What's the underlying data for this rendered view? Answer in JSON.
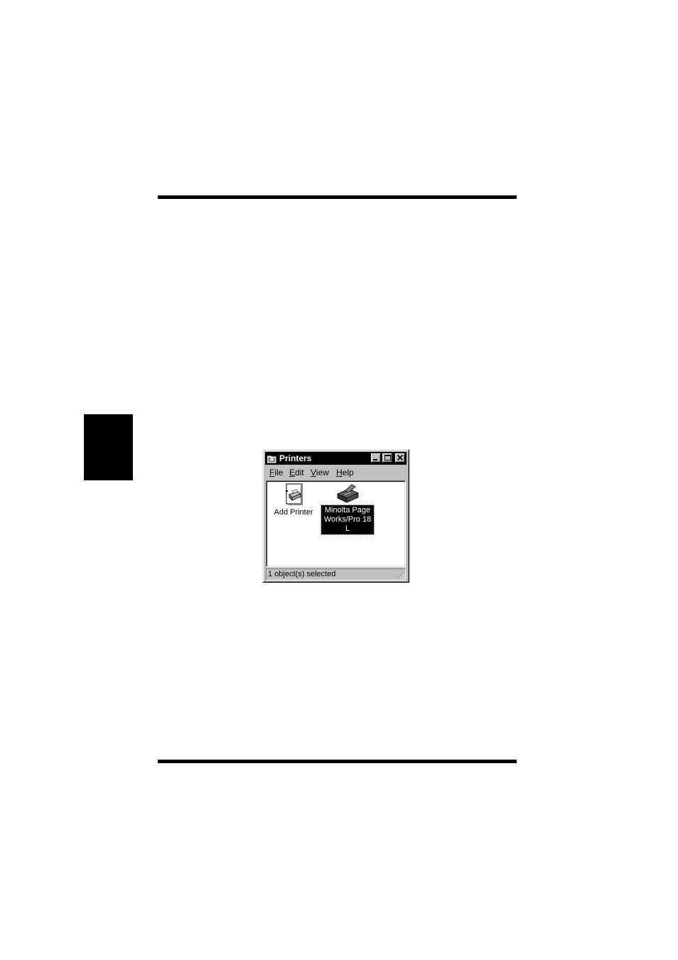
{
  "window": {
    "title": "Printers",
    "title_icon": "printers-folder-icon"
  },
  "menu": {
    "file": {
      "accel": "F",
      "rest": "ile"
    },
    "edit": {
      "accel": "E",
      "rest": "dit"
    },
    "view": {
      "accel": "V",
      "rest": "iew"
    },
    "help": {
      "accel": "H",
      "rest": "elp"
    }
  },
  "items": [
    {
      "label": "Add Printer",
      "icon": "add-printer-icon",
      "selected": false
    },
    {
      "label": "Minolta PageWorks/Pro 18L",
      "icon": "printer-icon",
      "selected": true
    }
  ],
  "status": {
    "text": "1 object(s) selected"
  },
  "colors": {
    "titlebar_bg": "#000000",
    "face": "#c0c0c0",
    "selection_bg": "#000000"
  }
}
